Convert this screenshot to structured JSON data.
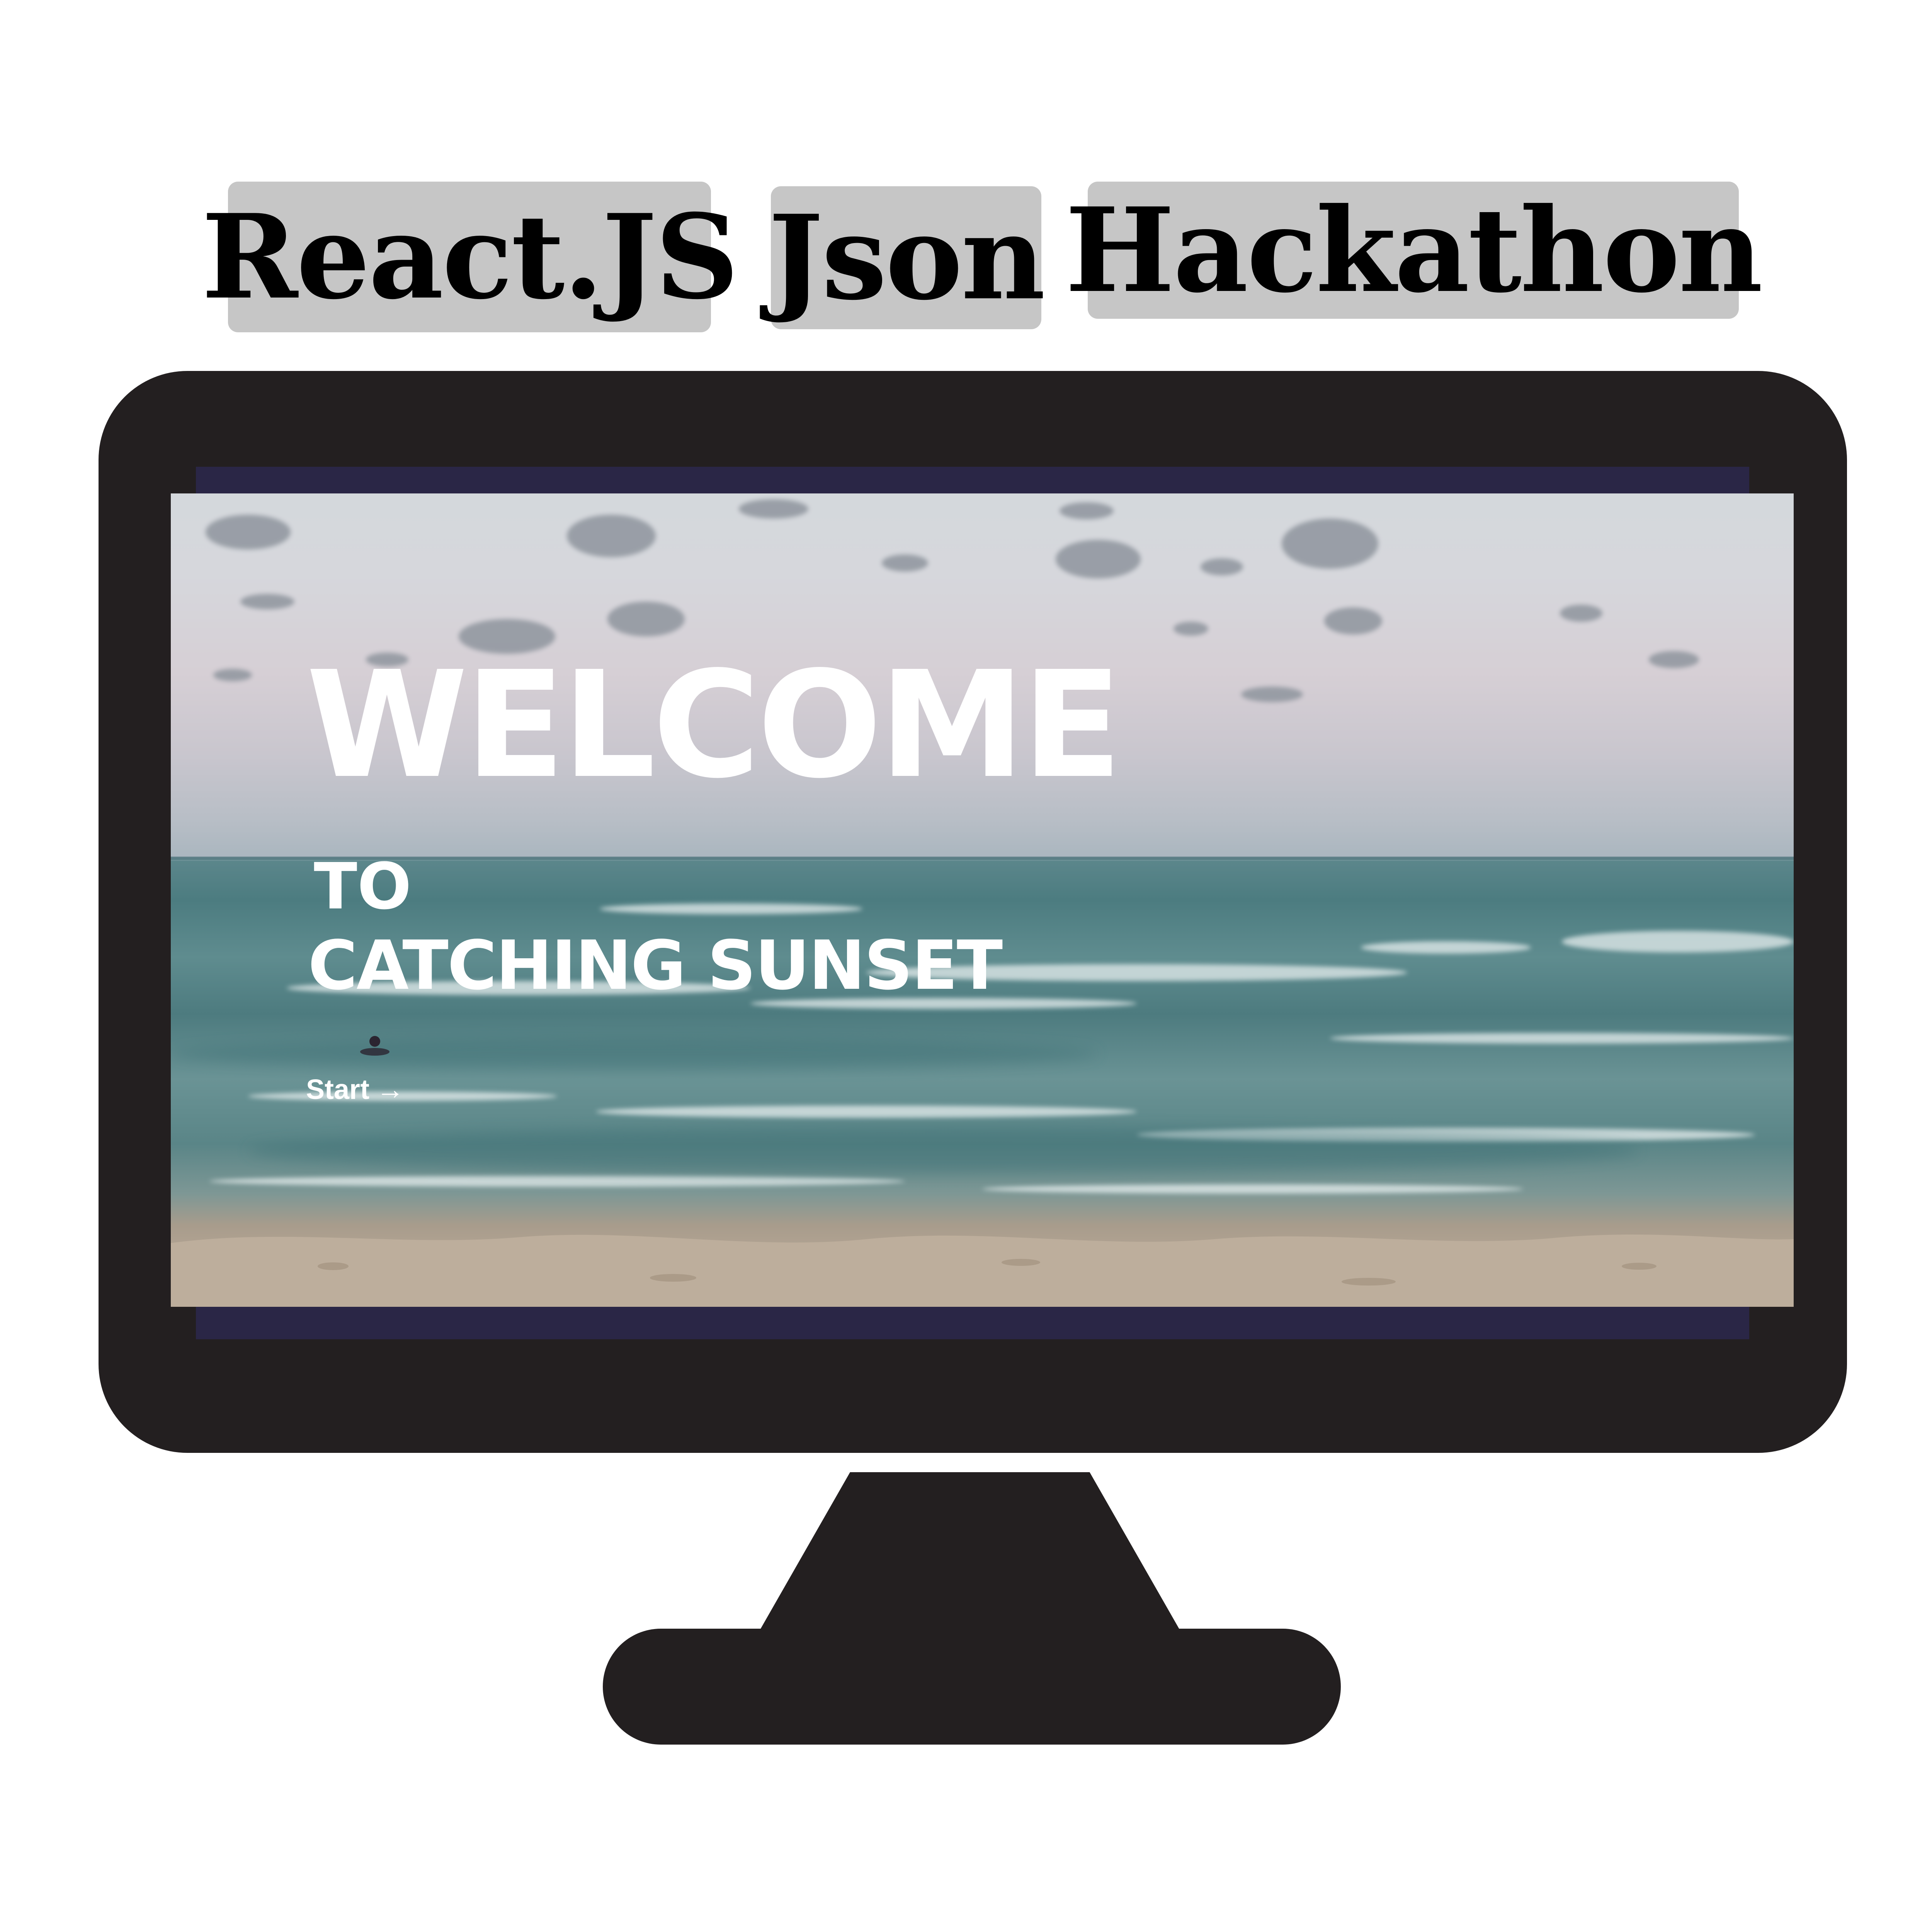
{
  "tags": {
    "react": "React.JS",
    "json": "Json",
    "hackathon": "Hackathon"
  },
  "screen": {
    "title": "WELCOME",
    "to": "TO",
    "subtitle": "CATCHING SUNSET",
    "start_label": "Start",
    "start_arrow": "→"
  },
  "colors": {
    "tag_background": "#c6c6c6",
    "monitor": "#231f20",
    "screen_frame": "#2a2646",
    "text_on_screen": "#ffffff"
  },
  "icons": {
    "start_arrow": "right-arrow-icon"
  }
}
